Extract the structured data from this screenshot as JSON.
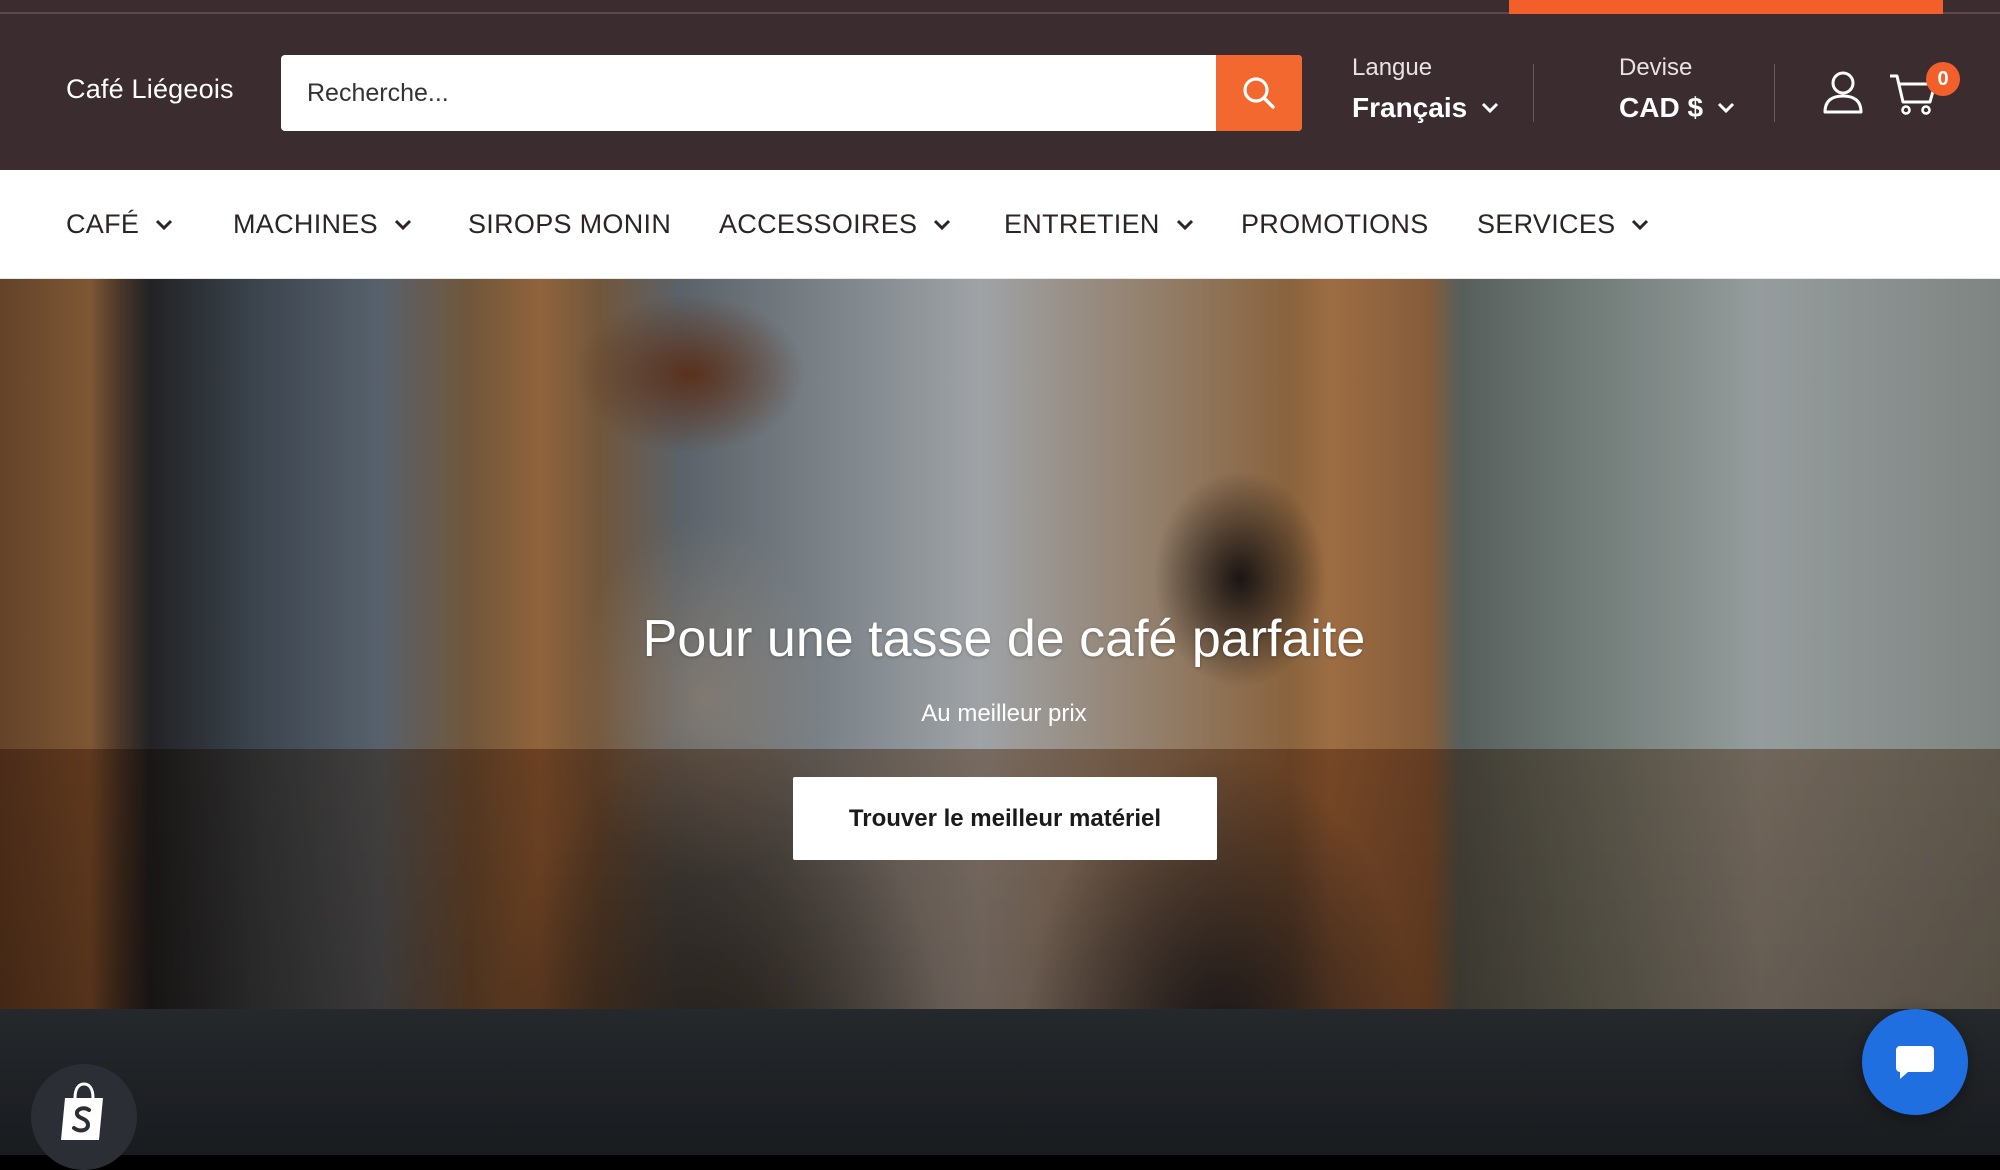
{
  "header": {
    "store_name": "Café Liégeois",
    "search": {
      "placeholder": "Recherche..."
    },
    "language": {
      "label": "Langue",
      "value": "Français"
    },
    "currency": {
      "label": "Devise",
      "value": "CAD $"
    },
    "cart": {
      "count": "0"
    },
    "icons": {
      "search": "search-icon",
      "account": "user-icon",
      "cart": "cart-icon"
    },
    "colors": {
      "background": "#3b2c2f",
      "accent": "#f25f2a"
    }
  },
  "nav": {
    "items": [
      {
        "label": "CAFÉ",
        "has_dropdown": true
      },
      {
        "label": "MACHINES",
        "has_dropdown": true
      },
      {
        "label": "SIROPS MONIN",
        "has_dropdown": false
      },
      {
        "label": "ACCESSOIRES",
        "has_dropdown": true
      },
      {
        "label": "ENTRETIEN",
        "has_dropdown": true
      },
      {
        "label": "PROMOTIONS",
        "has_dropdown": false
      },
      {
        "label": "SERVICES",
        "has_dropdown": true
      }
    ]
  },
  "hero": {
    "title": "Pour une tasse de café parfaite",
    "subtitle": "Au meilleur prix",
    "cta_label": "Trouver le meilleur matériel"
  },
  "widgets": {
    "shopify_icon": "shopify-bag-icon",
    "chat_icon": "chat-bubble-icon",
    "chat_color": "#1f6fe0"
  }
}
